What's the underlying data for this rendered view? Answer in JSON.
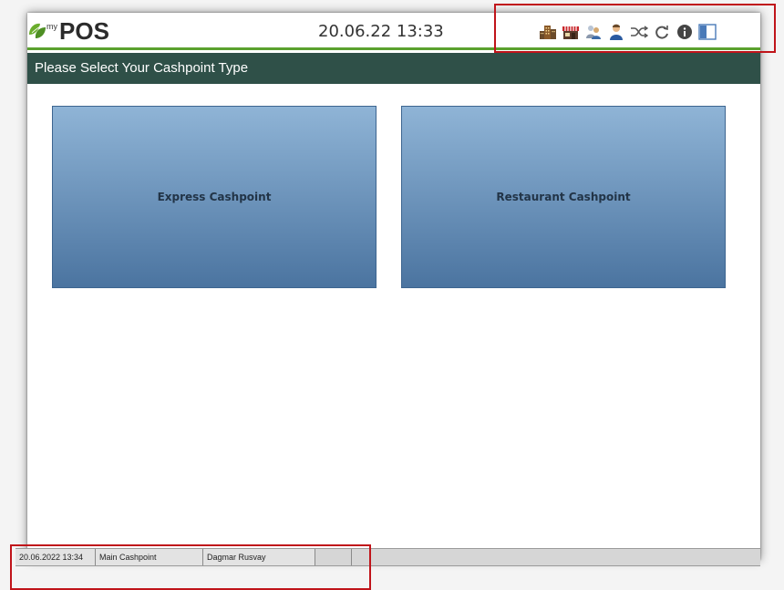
{
  "header": {
    "logo_prefix": "my",
    "logo_text": "POS",
    "datetime": "20.06.22  13:33",
    "icons": [
      "building-icon",
      "store-icon",
      "user-group-icon",
      "user-icon",
      "shuffle-icon",
      "refresh-icon",
      "info-icon",
      "panel-icon"
    ]
  },
  "title": "Please Select Your Cashpoint Type",
  "buttons": {
    "express": "Express Cashpoint",
    "restaurant": "Restaurant Cashpoint"
  },
  "status": {
    "datetime": "20.06.2022 13:34",
    "cashpoint": "Main Cashpoint",
    "user": "Dagmar Rusvay",
    "empty1": "",
    "empty2": ""
  },
  "colors": {
    "accent_green": "#5ba12e",
    "titlebar": "#2f5048",
    "button_top": "#8fb4d6",
    "button_bottom": "#4b74a0",
    "highlight": "#c0141a"
  }
}
